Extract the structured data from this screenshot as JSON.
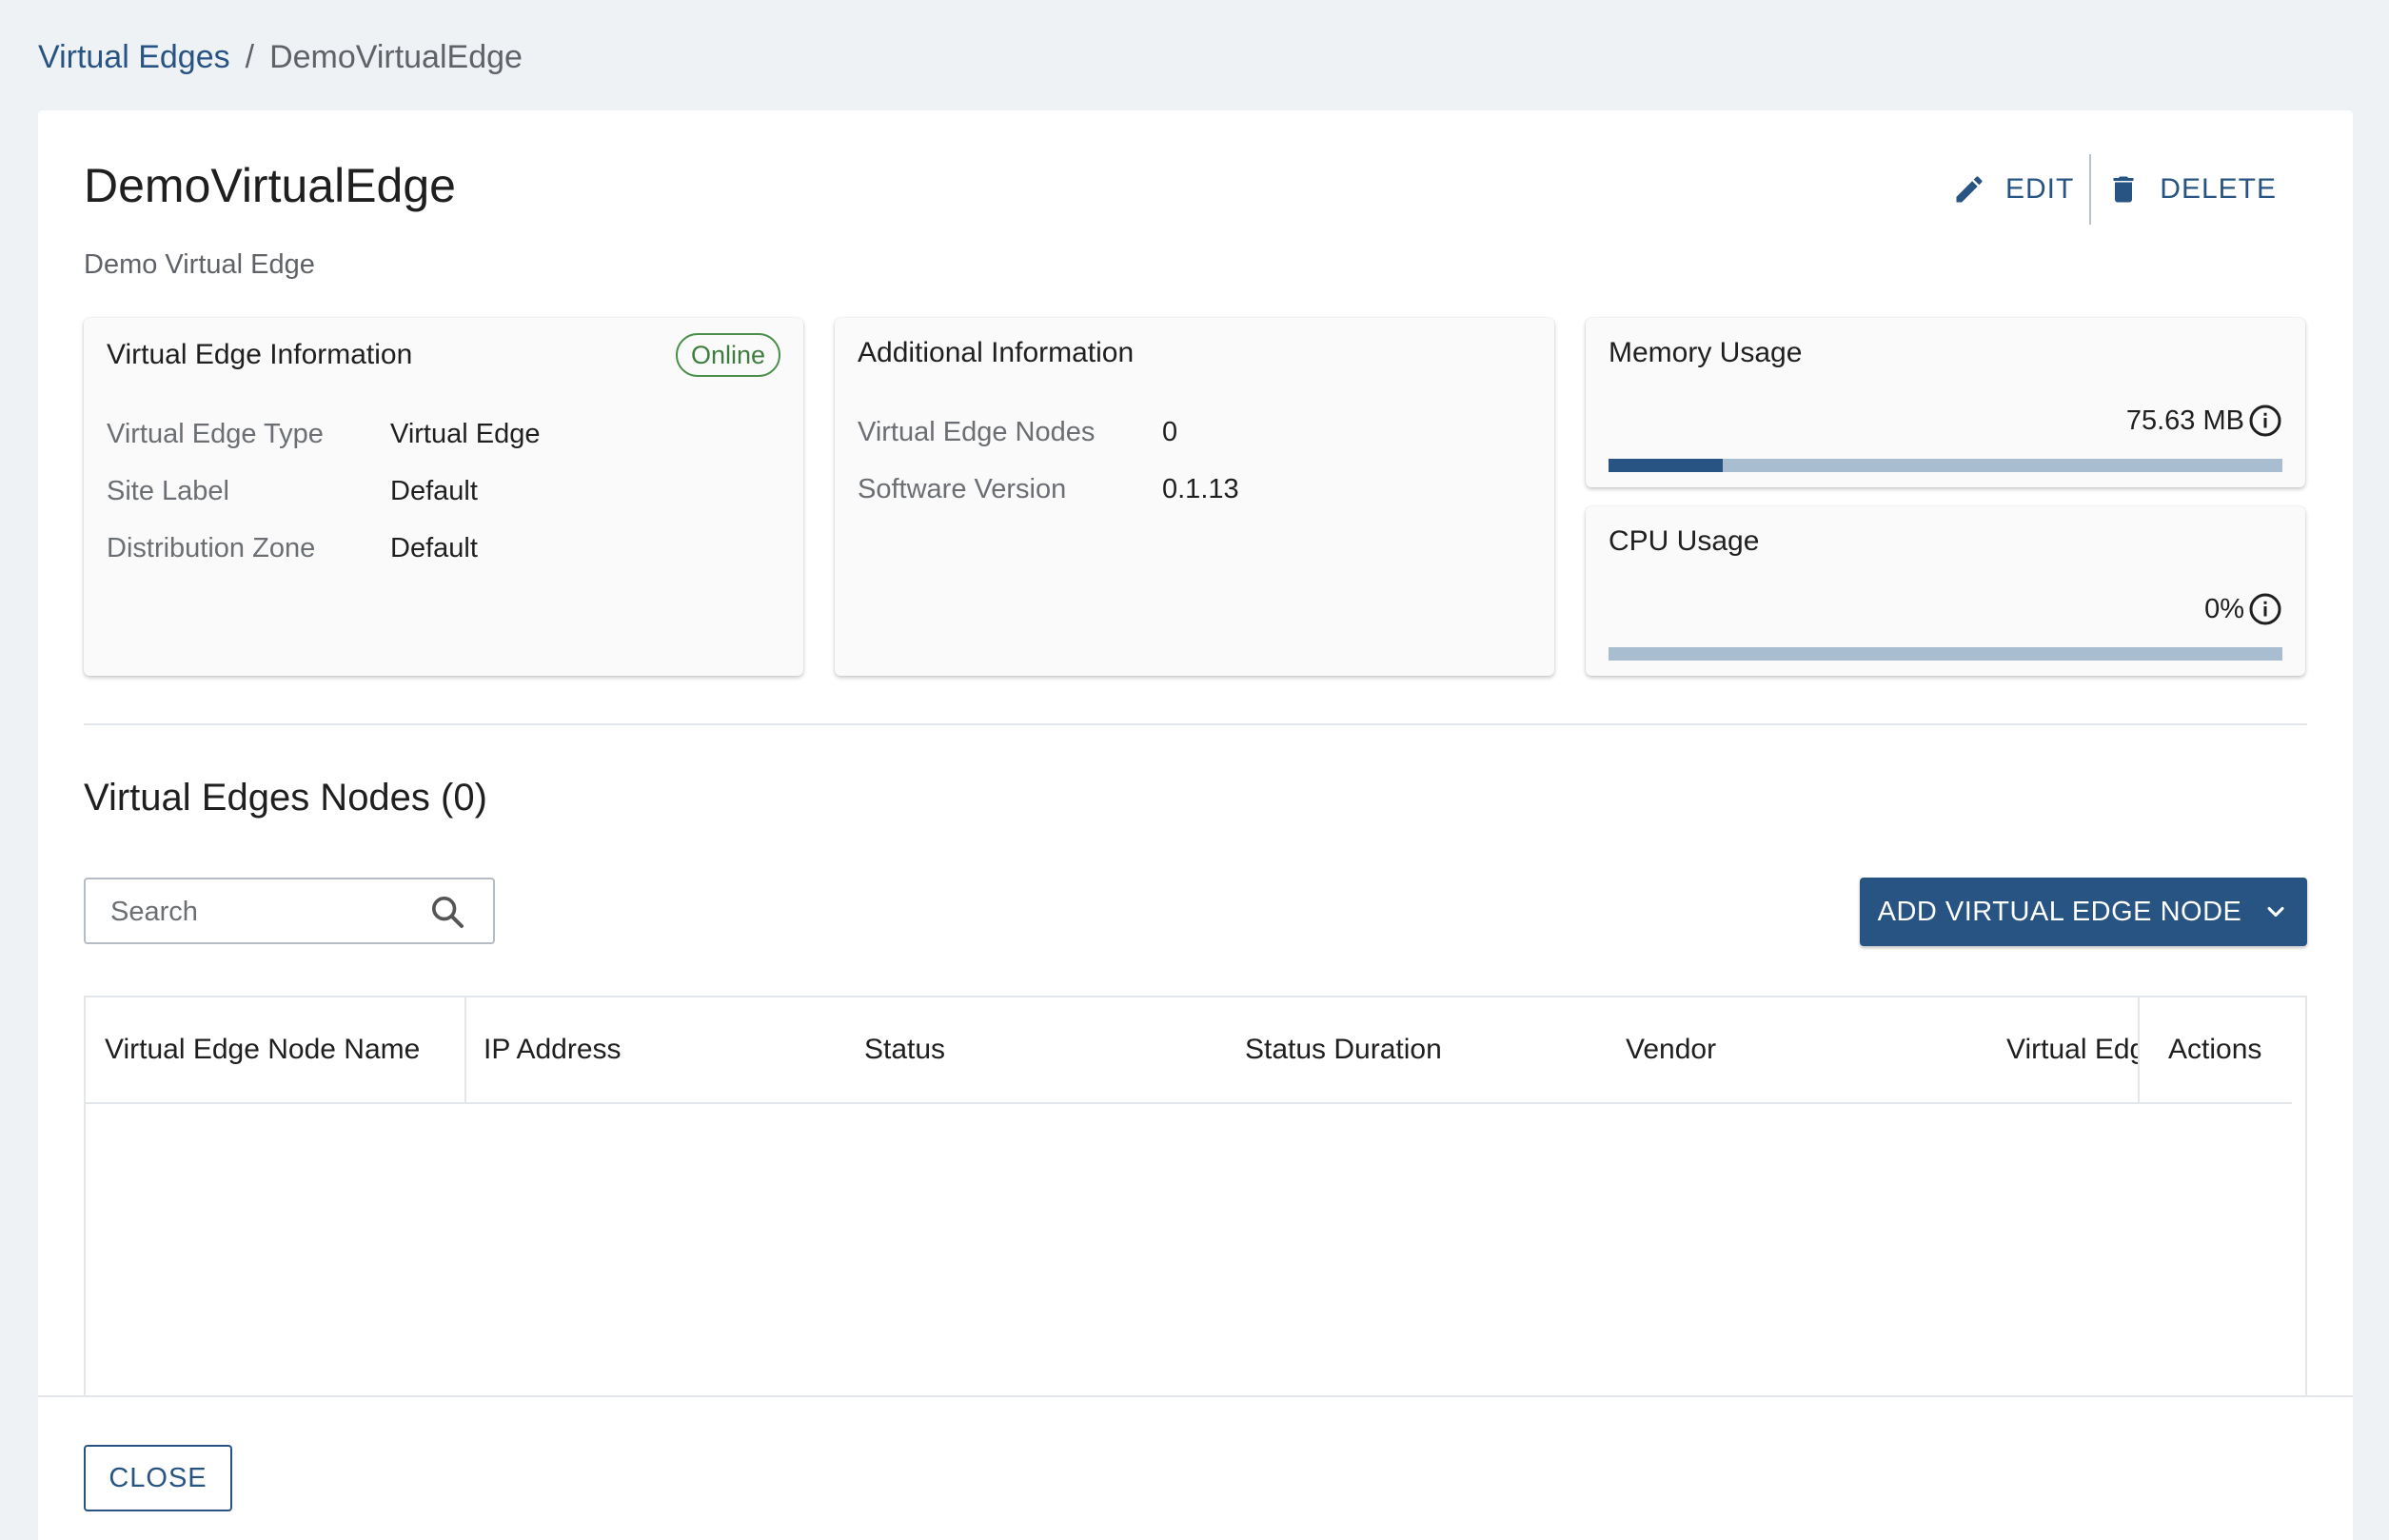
{
  "breadcrumb": {
    "parent": "Virtual Edges",
    "separator": "/",
    "current": "DemoVirtualEdge"
  },
  "header": {
    "title": "DemoVirtualEdge",
    "description": "Demo Virtual Edge",
    "edit_label": "EDIT",
    "delete_label": "DELETE"
  },
  "info_card": {
    "title": "Virtual Edge Information",
    "status": "Online",
    "rows": [
      {
        "key": "Virtual Edge Type",
        "value": "Virtual Edge"
      },
      {
        "key": "Site Label",
        "value": "Default"
      },
      {
        "key": "Distribution Zone",
        "value": "Default"
      }
    ]
  },
  "additional_card": {
    "title": "Additional Information",
    "rows": [
      {
        "key": "Virtual Edge Nodes",
        "value": "0"
      },
      {
        "key": "Software Version",
        "value": "0.1.13"
      }
    ]
  },
  "memory": {
    "title": "Memory Usage",
    "value": "75.63 MB",
    "fraction": 0.17
  },
  "cpu": {
    "title": "CPU Usage",
    "value": "0%",
    "fraction": 0
  },
  "nodes": {
    "title": "Virtual Edges Nodes (0)",
    "search_placeholder": "Search",
    "add_label": "ADD VIRTUAL EDGE NODE",
    "columns": [
      "Virtual Edge Node Name",
      "IP Address",
      "Status",
      "Status Duration",
      "Vendor",
      "Virtual Edge",
      "Actions"
    ]
  },
  "footer": {
    "close_label": "CLOSE"
  },
  "colors": {
    "primary": "#275482",
    "online_green": "#3e7d3e",
    "bar_track": "#a9bdd0"
  },
  "icons": [
    "pencil-icon",
    "trash-icon",
    "info-icon",
    "search-icon",
    "chevron-down-icon"
  ]
}
